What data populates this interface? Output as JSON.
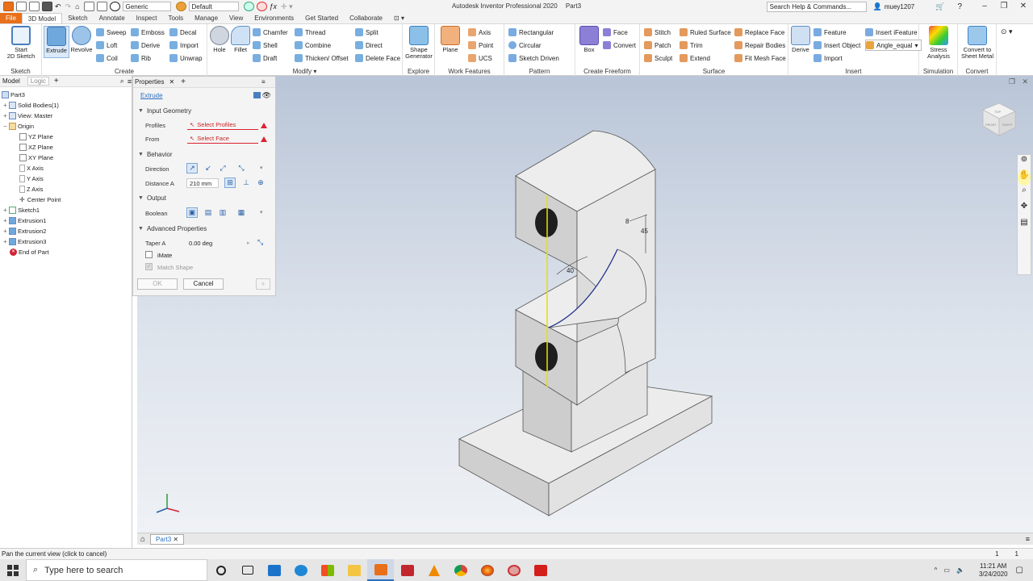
{
  "titlebar": {
    "appearance": "Generic",
    "style": "Default",
    "title": "Autodesk Inventor Professional 2020",
    "document": "Part3",
    "help_search": "Search Help & Commands...",
    "user": "muey1207"
  },
  "tabs": [
    "File",
    "3D Model",
    "Sketch",
    "Annotate",
    "Inspect",
    "Tools",
    "Manage",
    "View",
    "Environments",
    "Get Started",
    "Collaborate"
  ],
  "ribbon": {
    "sketch": {
      "start": "Start",
      "start2": "2D Sketch",
      "label": "Sketch"
    },
    "create": {
      "label": "Create",
      "extrude": "Extrude",
      "revolve": "Revolve",
      "sweep": "Sweep",
      "loft": "Loft",
      "coil": "Coil",
      "emboss": "Emboss",
      "derive": "Derive",
      "rib": "Rib",
      "decal": "Decal",
      "import": "Import",
      "unwrap": "Unwrap"
    },
    "modify": {
      "label": "Modify",
      "hole": "Hole",
      "fillet": "Fillet",
      "chamfer": "Chamfer",
      "shell": "Shell",
      "draft": "Draft",
      "thread": "Thread",
      "combine": "Combine",
      "thicken": "Thicken/ Offset",
      "split": "Split",
      "direct": "Direct",
      "delete_face": "Delete Face"
    },
    "explore": {
      "label": "Explore",
      "shape": "Shape",
      "shape2": "Generator"
    },
    "work": {
      "label": "Work Features",
      "plane": "Plane",
      "axis": "Axis",
      "point": "Point",
      "ucs": "UCS"
    },
    "pattern": {
      "label": "Pattern",
      "rectangular": "Rectangular",
      "circular": "Circular",
      "sketch_driven": "Sketch Driven"
    },
    "freeform": {
      "label": "Create Freeform",
      "box": "Box",
      "face": "Face",
      "convert": "Convert"
    },
    "surface": {
      "label": "Surface",
      "stitch": "Stitch",
      "patch": "Patch",
      "sculpt": "Sculpt",
      "ruled": "Ruled Surface",
      "trim": "Trim",
      "extend": "Extend",
      "replace": "Replace Face",
      "repair": "Repair Bodies",
      "fitmesh": "Fit Mesh Face"
    },
    "insert": {
      "label": "Insert",
      "derive": "Derive",
      "feature": "Feature",
      "insert_object": "Insert Object",
      "import": "Import",
      "ifeature": "Insert iFeature",
      "angle": "Angle_equal"
    },
    "simulation": {
      "label": "Simulation",
      "stress": "Stress",
      "stress2": "Analysis"
    },
    "convert": {
      "label": "Convert",
      "sheet": "Convert to",
      "sheet2": "Sheet Metal"
    }
  },
  "browser": {
    "tab_model": "Model",
    "tab_logic": "Logic",
    "tree": [
      "Part3",
      "Solid Bodies(1)",
      "View: Master",
      "Origin",
      "YZ Plane",
      "XZ Plane",
      "XY Plane",
      "X Axis",
      "Y Axis",
      "Z Axis",
      "Center Point",
      "Sketch1",
      "Extrusion1",
      "Extrusion2",
      "Extrusion3",
      "End of Part"
    ]
  },
  "properties": {
    "tab": "Properties",
    "feature": "Extrude",
    "input_geometry": "Input Geometry",
    "profiles_label": "Profiles",
    "profiles_value": "Select Profiles",
    "from_label": "From",
    "from_value": "Select Face",
    "behavior": "Behavior",
    "direction_label": "Direction",
    "distance_label": "Distance A",
    "distance_value": "210 mm",
    "output": "Output",
    "boolean_label": "Boolean",
    "advanced": "Advanced Properties",
    "taper_label": "Taper A",
    "taper_value": "0.00 deg",
    "imate": "iMate",
    "match_shape": "Match Shape",
    "ok": "OK",
    "cancel": "Cancel"
  },
  "viewport": {
    "dims": {
      "d1": "8",
      "d2": "45",
      "d3": "40"
    },
    "viewcube_top": "TOP",
    "viewcube_front": "FRONT",
    "viewcube_right": "RIGHT"
  },
  "doc_tab": "Part3",
  "status": {
    "text": "Pan the current view (click to cancel)",
    "n1": "1",
    "n2": "1"
  },
  "taskbar": {
    "search": "Type here to search",
    "time": "11:21 AM",
    "date": "3/24/2020"
  },
  "colors": {
    "file_tab": "#e8701a",
    "selection_blue": "#2a6fbf",
    "warning": "#d22233",
    "viewport_top": "#b9c5d7",
    "part_face": "#d8d8d8"
  }
}
